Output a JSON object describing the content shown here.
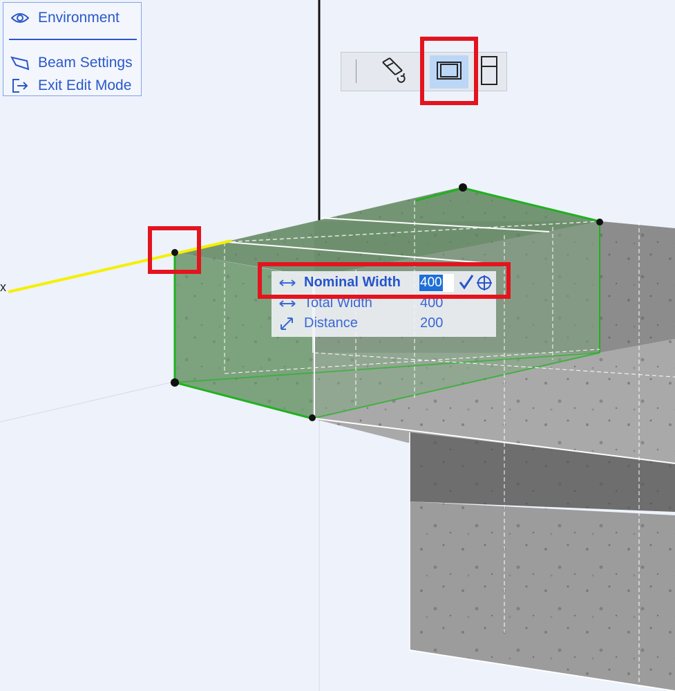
{
  "context_menu": {
    "items": [
      {
        "label": "Environment",
        "icon": "eye-icon"
      },
      {
        "label": "Beam Settings",
        "icon": "beam-icon"
      },
      {
        "label": "Exit Edit Mode",
        "icon": "exit-icon"
      }
    ]
  },
  "toolbar": {
    "buttons": [
      {
        "name": "flip-reference-line",
        "icon": "flip-reference-line-icon",
        "active": false
      },
      {
        "name": "cross-section-view",
        "icon": "cross-section-icon",
        "active": true
      },
      {
        "name": "side-profile-view",
        "icon": "side-profile-icon",
        "active": false
      }
    ]
  },
  "axis": {
    "label": "x"
  },
  "tracker": {
    "rows": [
      {
        "label": "Nominal Width",
        "value": "400",
        "icon": "horizontal-arrow-icon",
        "editing": true
      },
      {
        "label": "Total Width",
        "value": "400",
        "icon": "horizontal-arrow-icon",
        "editing": false
      },
      {
        "label": "Distance",
        "value": "200",
        "icon": "diagonal-arrow-icon",
        "editing": false
      }
    ],
    "accept_icon": "checkmark-icon",
    "snap_icon": "crosshair-icon"
  },
  "colors": {
    "accent": "#2a58c9",
    "highlight": "#e3141e",
    "selection_green": "#1fb21f",
    "axis_yellow": "#f5f000",
    "concrete": "#9b9b9b"
  }
}
